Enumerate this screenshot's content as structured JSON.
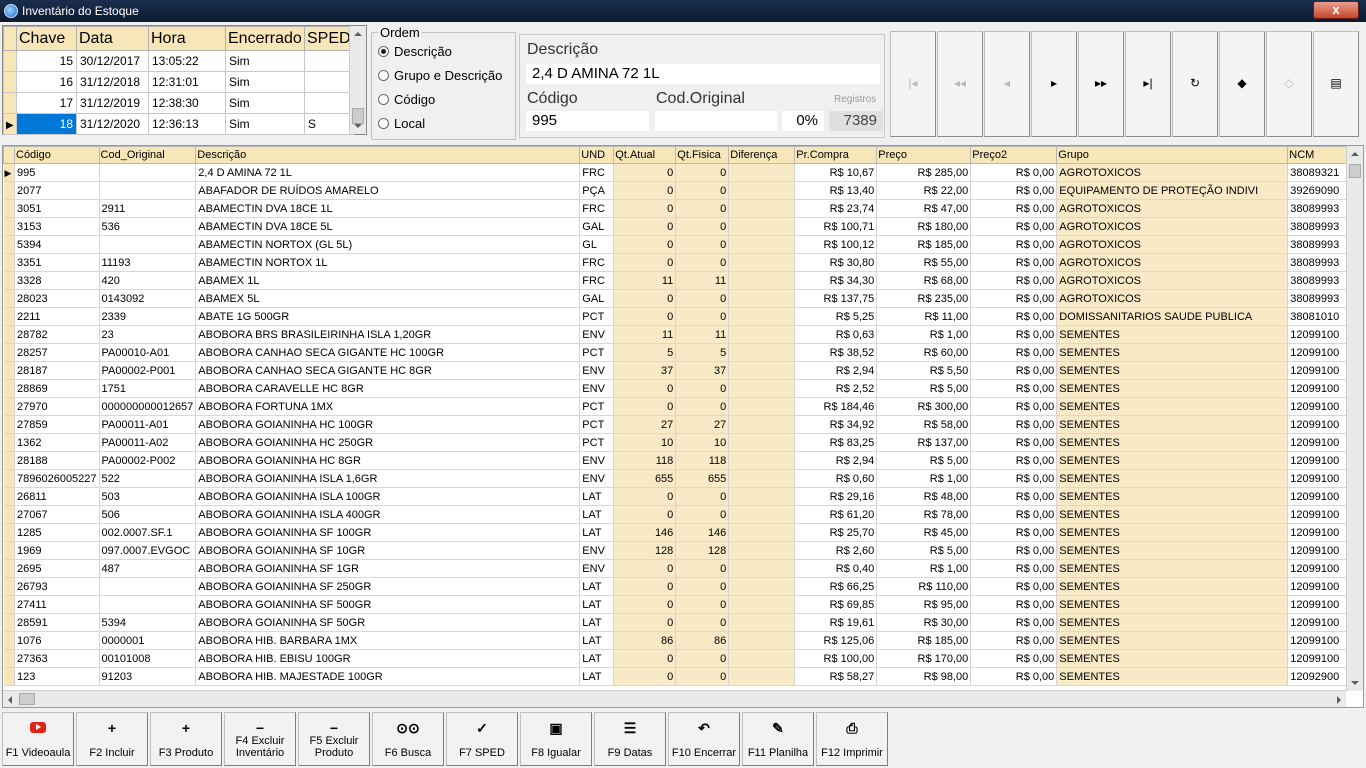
{
  "window": {
    "title": "Inventário do Estoque",
    "close_label": "x"
  },
  "inventory": {
    "headers": [
      "Chave",
      "Data",
      "Hora",
      "Encerrado",
      "SPED"
    ],
    "rows": [
      [
        "15",
        "30/12/2017",
        "13:05:22",
        "Sim",
        ""
      ],
      [
        "16",
        "31/12/2018",
        "12:31:01",
        "Sim",
        ""
      ],
      [
        "17",
        "31/12/2019",
        "12:38:30",
        "Sim",
        ""
      ],
      [
        "18",
        "31/12/2020",
        "12:36:13",
        "Sim",
        "S"
      ]
    ],
    "selected_row_index": 3
  },
  "ordem": {
    "legend": "Ordem",
    "options": [
      "Descrição",
      "Grupo e Descrição",
      "Código",
      "Local"
    ],
    "selected_index": 0
  },
  "detail": {
    "descricao_label": "Descrição",
    "descricao_value": "2,4 D AMINA 72  1L",
    "codigo_label": "Código",
    "codigo_value": "995",
    "cod_original_label": "Cod.Original",
    "cod_original_value": "",
    "percent": "0%",
    "registros_label": "Registros",
    "registros_value": "7389"
  },
  "nav_buttons": [
    {
      "name": "first-record-button",
      "icon": "|◂",
      "enabled": false
    },
    {
      "name": "prior-page-button",
      "icon": "◂◂",
      "enabled": false
    },
    {
      "name": "prior-record-button",
      "icon": "◂",
      "enabled": false
    },
    {
      "name": "next-record-button",
      "icon": "▸",
      "enabled": true
    },
    {
      "name": "next-page-button",
      "icon": "▸▸",
      "enabled": true
    },
    {
      "name": "last-record-button",
      "icon": "▸|",
      "enabled": true
    },
    {
      "name": "refresh-button",
      "icon": "↻",
      "enabled": true
    },
    {
      "name": "eraser-icon",
      "icon": "◆",
      "enabled": true
    },
    {
      "name": "goto-icon",
      "icon": "◇",
      "enabled": false
    },
    {
      "name": "form-view-icon",
      "icon": "▤",
      "enabled": true
    }
  ],
  "grid": {
    "headers": [
      "Código",
      "Cod_Original",
      "Descrição",
      "UND",
      "Qt.Atual",
      "Qt.Fisica",
      "Diferença",
      "Pr.Compra",
      "Preço",
      "Preço2",
      "Grupo",
      "NCM"
    ],
    "rows": [
      [
        "995",
        "",
        "2,4 D AMINA 72  1L",
        "FRC",
        "0",
        "0",
        "",
        "R$ 10,67",
        "R$ 285,00",
        "R$ 0,00",
        "AGROTOXICOS",
        "38089321"
      ],
      [
        "2077",
        "",
        "ABAFADOR DE RUÍDOS AMARELO",
        "PÇA",
        "0",
        "0",
        "",
        "R$ 13,40",
        "R$ 22,00",
        "R$ 0,00",
        "EQUIPAMENTO DE PROTEÇÃO INDIVI",
        "39269090"
      ],
      [
        "3051",
        "2911",
        "ABAMECTIN DVA 18CE 1L",
        "FRC",
        "0",
        "0",
        "",
        "R$ 23,74",
        "R$ 47,00",
        "R$ 0,00",
        "AGROTOXICOS",
        "38089993"
      ],
      [
        "3153",
        "536",
        "ABAMECTIN DVA 18CE 5L",
        "GAL",
        "0",
        "0",
        "",
        "R$ 100,71",
        "R$ 180,00",
        "R$ 0,00",
        "AGROTOXICOS",
        "38089993"
      ],
      [
        "5394",
        "",
        "ABAMECTIN NORTOX (GL 5L)",
        "GL",
        "0",
        "0",
        "",
        "R$ 100,12",
        "R$ 185,00",
        "R$ 0,00",
        "AGROTOXICOS",
        "38089993"
      ],
      [
        "3351",
        "11193",
        "ABAMECTIN NORTOX 1L",
        "FRC",
        "0",
        "0",
        "",
        "R$ 30,80",
        "R$ 55,00",
        "R$ 0,00",
        "AGROTOXICOS",
        "38089993"
      ],
      [
        "3328",
        "420",
        "ABAMEX 1L",
        "FRC",
        "11",
        "11",
        "",
        "R$ 34,30",
        "R$ 68,00",
        "R$ 0,00",
        "AGROTOXICOS",
        "38089993"
      ],
      [
        "28023",
        "0143092",
        "ABAMEX 5L",
        "GAL",
        "0",
        "0",
        "",
        "R$ 137,75",
        "R$ 235,00",
        "R$ 0,00",
        "AGROTOXICOS",
        "38089993"
      ],
      [
        "2211",
        "2339",
        "ABATE 1G 500GR",
        "PCT",
        "0",
        "0",
        "",
        "R$ 5,25",
        "R$ 11,00",
        "R$ 0,00",
        "DOMISSANITARIOS SAUDE PUBLICA",
        "38081010"
      ],
      [
        "28782",
        "23",
        "ABOBORA BRS BRASILEIRINHA ISLA 1,20GR",
        "ENV",
        "11",
        "11",
        "",
        "R$ 0,63",
        "R$ 1,00",
        "R$ 0,00",
        "SEMENTES",
        "12099100"
      ],
      [
        "28257",
        "PA00010-A01",
        "ABOBORA CANHAO SECA GIGANTE HC 100GR",
        "PCT",
        "5",
        "5",
        "",
        "R$ 38,52",
        "R$ 60,00",
        "R$ 0,00",
        "SEMENTES",
        "12099100"
      ],
      [
        "28187",
        "PA00002-P001",
        "ABOBORA CANHAO SECA GIGANTE HC 8GR",
        "ENV",
        "37",
        "37",
        "",
        "R$ 2,94",
        "R$ 5,50",
        "R$ 0,00",
        "SEMENTES",
        "12099100"
      ],
      [
        "28869",
        "1751",
        "ABOBORA CARAVELLE HC 8GR",
        "ENV",
        "0",
        "0",
        "",
        "R$ 2,52",
        "R$ 5,00",
        "R$ 0,00",
        "SEMENTES",
        "12099100"
      ],
      [
        "27970",
        "000000000012657",
        "ABOBORA FORTUNA 1MX",
        "PCT",
        "0",
        "0",
        "",
        "R$ 184,46",
        "R$ 300,00",
        "R$ 0,00",
        "SEMENTES",
        "12099100"
      ],
      [
        "27859",
        "PA00011-A01",
        "ABOBORA GOIANINHA HC 100GR",
        "PCT",
        "27",
        "27",
        "",
        "R$ 34,92",
        "R$ 58,00",
        "R$ 0,00",
        "SEMENTES",
        "12099100"
      ],
      [
        "1362",
        "PA00011-A02",
        "ABOBORA GOIANINHA HC 250GR",
        "PCT",
        "10",
        "10",
        "",
        "R$ 83,25",
        "R$ 137,00",
        "R$ 0,00",
        "SEMENTES",
        "12099100"
      ],
      [
        "28188",
        "PA00002-P002",
        "ABOBORA GOIANINHA HC 8GR",
        "ENV",
        "118",
        "118",
        "",
        "R$ 2,94",
        "R$ 5,00",
        "R$ 0,00",
        "SEMENTES",
        "12099100"
      ],
      [
        "7896026005227",
        "522",
        "ABOBORA GOIANINHA ISLA 1,6GR",
        "ENV",
        "655",
        "655",
        "",
        "R$ 0,60",
        "R$ 1,00",
        "R$ 0,00",
        "SEMENTES",
        "12099100"
      ],
      [
        "26811",
        "503",
        "ABOBORA GOIANINHA ISLA 100GR",
        "LAT",
        "0",
        "0",
        "",
        "R$ 29,16",
        "R$ 48,00",
        "R$ 0,00",
        "SEMENTES",
        "12099100"
      ],
      [
        "27067",
        "506",
        "ABOBORA GOIANINHA ISLA 400GR",
        "LAT",
        "0",
        "0",
        "",
        "R$ 61,20",
        "R$ 78,00",
        "R$ 0,00",
        "SEMENTES",
        "12099100"
      ],
      [
        "1285",
        "002.0007.SF.1",
        "ABOBORA GOIANINHA SF 100GR",
        "LAT",
        "146",
        "146",
        "",
        "R$ 25,70",
        "R$ 45,00",
        "R$ 0,00",
        "SEMENTES",
        "12099100"
      ],
      [
        "1969",
        "097.0007.EVGOC",
        "ABOBORA GOIANINHA SF 10GR",
        "ENV",
        "128",
        "128",
        "",
        "R$ 2,60",
        "R$ 5,00",
        "R$ 0,00",
        "SEMENTES",
        "12099100"
      ],
      [
        "2695",
        "487",
        "ABOBORA GOIANINHA SF 1GR",
        "ENV",
        "0",
        "0",
        "",
        "R$ 0,40",
        "R$ 1,00",
        "R$ 0,00",
        "SEMENTES",
        "12099100"
      ],
      [
        "26793",
        "",
        "ABOBORA GOIANINHA SF 250GR",
        "LAT",
        "0",
        "0",
        "",
        "R$ 66,25",
        "R$ 110,00",
        "R$ 0,00",
        "SEMENTES",
        "12099100"
      ],
      [
        "27411",
        "",
        "ABOBORA GOIANINHA SF 500GR",
        "LAT",
        "0",
        "0",
        "",
        "R$ 69,85",
        "R$ 95,00",
        "R$ 0,00",
        "SEMENTES",
        "12099100"
      ],
      [
        "28591",
        "5394",
        "ABOBORA GOIANINHA SF 50GR",
        "LAT",
        "0",
        "0",
        "",
        "R$ 19,61",
        "R$ 30,00",
        "R$ 0,00",
        "SEMENTES",
        "12099100"
      ],
      [
        "1076",
        "0000001",
        "ABOBORA HIB. BARBARA 1MX",
        "LAT",
        "86",
        "86",
        "",
        "R$ 125,06",
        "R$ 185,00",
        "R$ 0,00",
        "SEMENTES",
        "12099100"
      ],
      [
        "27363",
        "00101008",
        "ABOBORA HIB. EBISU 100GR",
        "LAT",
        "0",
        "0",
        "",
        "R$ 100,00",
        "R$ 170,00",
        "R$ 0,00",
        "SEMENTES",
        "12099100"
      ],
      [
        "123",
        "91203",
        "ABOBORA HIB. MAJESTADE 100GR",
        "LAT",
        "0",
        "0",
        "",
        "R$ 58,27",
        "R$ 98,00",
        "R$ 0,00",
        "SEMENTES",
        "12092900"
      ]
    ]
  },
  "fkeys": [
    {
      "name": "f1-videoaula-button",
      "icon": "youtube-icon",
      "glyph": "",
      "label": "F1 Videoaula"
    },
    {
      "name": "f2-incluir-button",
      "icon": "plus-icon",
      "glyph": "+",
      "label": "F2 Incluir"
    },
    {
      "name": "f3-produto-button",
      "icon": "plus-icon",
      "glyph": "+",
      "label": "F3 Produto"
    },
    {
      "name": "f4-excluir-inventario-button",
      "icon": "minus-icon",
      "glyph": "−",
      "label": "F4 Excluir Inventário"
    },
    {
      "name": "f5-excluir-produto-button",
      "icon": "minus-icon",
      "glyph": "−",
      "label": "F5 Excluir Produto"
    },
    {
      "name": "f6-busca-button",
      "icon": "binoculars-icon",
      "glyph": "⊙⊙",
      "label": "F6 Busca"
    },
    {
      "name": "f7-sped-button",
      "icon": "check-icon",
      "glyph": "✓",
      "label": "F7 SPED"
    },
    {
      "name": "f8-igualar-button",
      "icon": "document-arrow-icon",
      "glyph": "▣",
      "label": "F8 Igualar"
    },
    {
      "name": "f9-datas-button",
      "icon": "list-icon",
      "glyph": "☰",
      "label": "F9 Datas"
    },
    {
      "name": "f10-encerrar-button",
      "icon": "undo-arrow-icon",
      "glyph": "↶",
      "label": "F10 Encerrar"
    },
    {
      "name": "f11-planilha-button",
      "icon": "spreadsheet-icon",
      "glyph": "✎",
      "label": "F11 Planilha"
    },
    {
      "name": "f12-imprimir-button",
      "icon": "printer-icon",
      "glyph": "⎙",
      "label": "F12 Imprimir"
    }
  ],
  "colors": {
    "header_bg": "#f6e6b8",
    "selection": "#0078d7",
    "title_bar": "#1a2e4f"
  }
}
